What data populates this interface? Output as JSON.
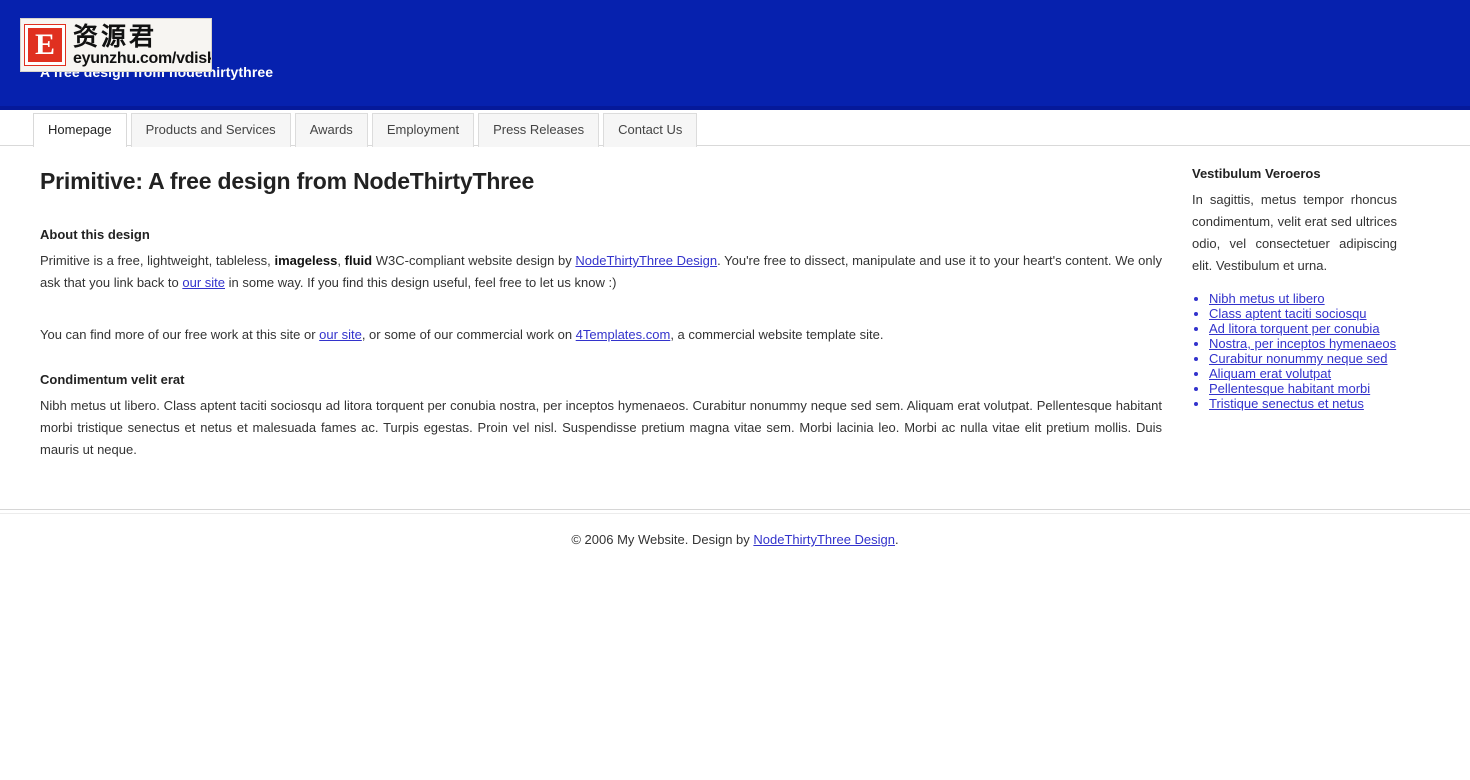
{
  "header": {
    "tagline": "A free design from nodethirtythree",
    "logo": {
      "mark_letter": "E",
      "cn_text": "资源君",
      "url_text": "eyunzhu.com/vdisk"
    },
    "background_color": "#0621AE"
  },
  "nav": {
    "items": [
      {
        "label": "Homepage",
        "active": true
      },
      {
        "label": "Products and Services",
        "active": false
      },
      {
        "label": "Awards",
        "active": false
      },
      {
        "label": "Employment",
        "active": false
      },
      {
        "label": "Press Releases",
        "active": false
      },
      {
        "label": "Contact Us",
        "active": false
      }
    ]
  },
  "content": {
    "page_title": "Primitive: A free design from NodeThirtyThree",
    "section1": {
      "heading": "About this design",
      "p1_a": "Primitive is a free, lightweight, tableless, ",
      "p1_b": "imageless",
      "p1_c": ", ",
      "p1_d": "fluid",
      "p1_e": " W3C-compliant website design by ",
      "p1_link1": "NodeThirtyThree Design",
      "p1_f": ". You're free to dissect, manipulate and use it to your heart's content. We only ask that you link back to ",
      "p1_link2": "our site",
      "p1_g": " in some way. If you find this design useful, feel free to let us know :)",
      "p2_a": "You can find more of our free work at this site or ",
      "p2_link1": "our site",
      "p2_b": ", or some of our commercial work on ",
      "p2_link2": "4Templates.com",
      "p2_c": ", a commercial website template site."
    },
    "section2": {
      "heading": "Condimentum velit erat",
      "body": "Nibh metus ut libero. Class aptent taciti sociosqu ad litora torquent per conubia nostra, per inceptos hymenaeos. Curabitur nonummy neque sed sem. Aliquam erat volutpat. Pellentesque habitant morbi tristique senectus et netus et malesuada fames ac. Turpis egestas. Proin vel nisl. Suspendisse pretium magna vitae sem. Morbi lacinia leo. Morbi ac nulla vitae elit pretium mollis. Duis mauris ut neque."
    }
  },
  "sidebar": {
    "heading": "Vestibulum Veroeros",
    "paragraph": "In sagittis, metus tempor rhoncus condimentum, velit erat sed ultrices odio, vel consectetuer adipiscing elit. Vestibulum et urna.",
    "links": [
      "Nibh metus ut libero",
      "Class aptent taciti sociosqu",
      "Ad litora torquent per conubia",
      "Nostra, per inceptos hymenaeos",
      "Curabitur nonummy neque sed",
      "Aliquam erat volutpat",
      "Pellentesque habitant morbi",
      "Tristique senectus et netus"
    ]
  },
  "footer": {
    "text_before": "© 2006 My Website. Design by ",
    "link": "NodeThirtyThree Design",
    "text_after": "."
  }
}
